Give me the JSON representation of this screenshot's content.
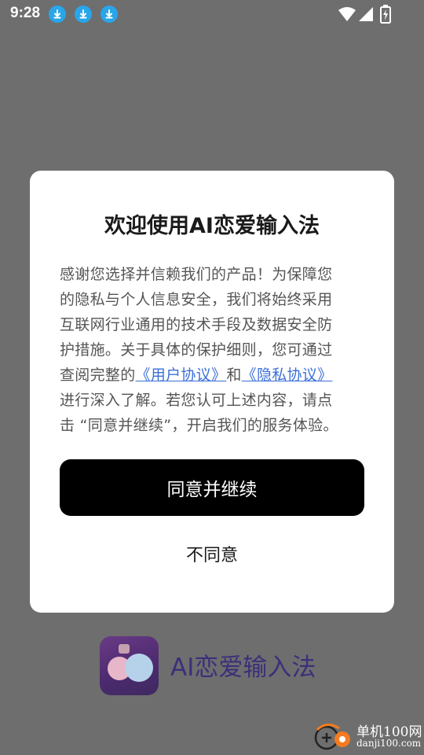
{
  "status_bar": {
    "time": "9:28",
    "icons": [
      "download-icon",
      "download-icon",
      "download-icon",
      "wifi-icon",
      "signal-icon",
      "battery-charging-icon"
    ]
  },
  "dialog": {
    "title": "欢迎使用AI恋爱输入法",
    "body_lines": [
      "感谢您选择并信赖我们的产品！为保障您",
      "的隐私与个人信息安全，我们将始终采用",
      "互联网行业通用的技术手段及数据安全防",
      "护措施。关于具体的保护细则，您可通过"
    ],
    "line5_prefix": "查阅完整的",
    "link_user_agreement": "《用户协议》",
    "and_text": "和",
    "link_privacy_agreement": "《隐私协议》",
    "body_lines_after": [
      "进行深入了解。若您认可上述内容，请点",
      "击 “同意并继续”，开启我们的服务体验。"
    ],
    "agree_button": "同意并继续",
    "disagree_button": "不同意"
  },
  "background_app": {
    "name": "AI恋爱输入法"
  },
  "watermark": {
    "name": "单机100网",
    "url": "danji100.com"
  },
  "colors": {
    "overlay": "#6e6e6e",
    "link": "#3a6fd8",
    "button": "#000000",
    "download_badge": "#29a6ea"
  }
}
